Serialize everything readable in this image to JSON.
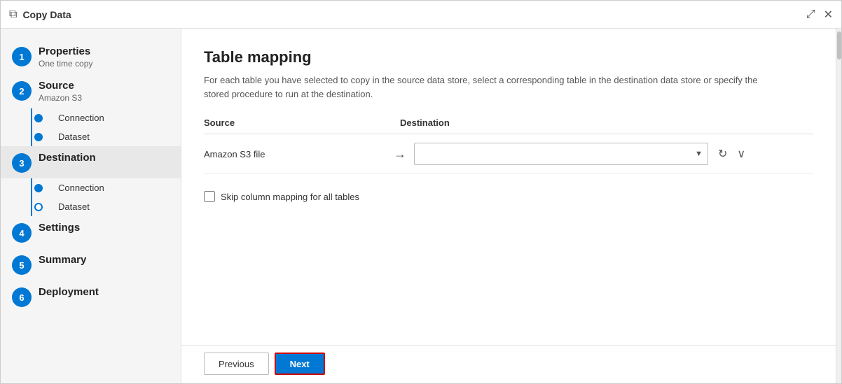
{
  "window": {
    "title": "Copy Data",
    "title_icon": "⧉",
    "expand_icon": "⤢",
    "close_icon": "✕"
  },
  "sidebar": {
    "steps": [
      {
        "id": 1,
        "label": "Properties",
        "sub": "One time copy",
        "active": false,
        "sub_steps": []
      },
      {
        "id": 2,
        "label": "Source",
        "sub": "Amazon S3",
        "active": false,
        "sub_steps": [
          {
            "label": "Connection",
            "filled": true
          },
          {
            "label": "Dataset",
            "filled": true
          }
        ]
      },
      {
        "id": 3,
        "label": "Destination",
        "sub": "",
        "active": true,
        "sub_steps": [
          {
            "label": "Connection",
            "filled": true
          },
          {
            "label": "Dataset",
            "filled": false
          }
        ]
      },
      {
        "id": 4,
        "label": "Settings",
        "sub": "",
        "active": false,
        "sub_steps": []
      },
      {
        "id": 5,
        "label": "Summary",
        "sub": "",
        "active": false,
        "sub_steps": []
      },
      {
        "id": 6,
        "label": "Deployment",
        "sub": "",
        "active": false,
        "sub_steps": []
      }
    ]
  },
  "main": {
    "title": "Table mapping",
    "description": "For each table you have selected to copy in the source data store, select a corresponding table in the destination data store or specify the stored procedure to run at the destination.",
    "mapping_header": {
      "source": "Source",
      "destination": "Destination"
    },
    "mapping_rows": [
      {
        "source_label": "Amazon S3 file",
        "destination_value": ""
      }
    ],
    "skip_checkbox_label": "Skip column mapping for all tables",
    "previous_button": "Previous",
    "next_button": "Next"
  }
}
